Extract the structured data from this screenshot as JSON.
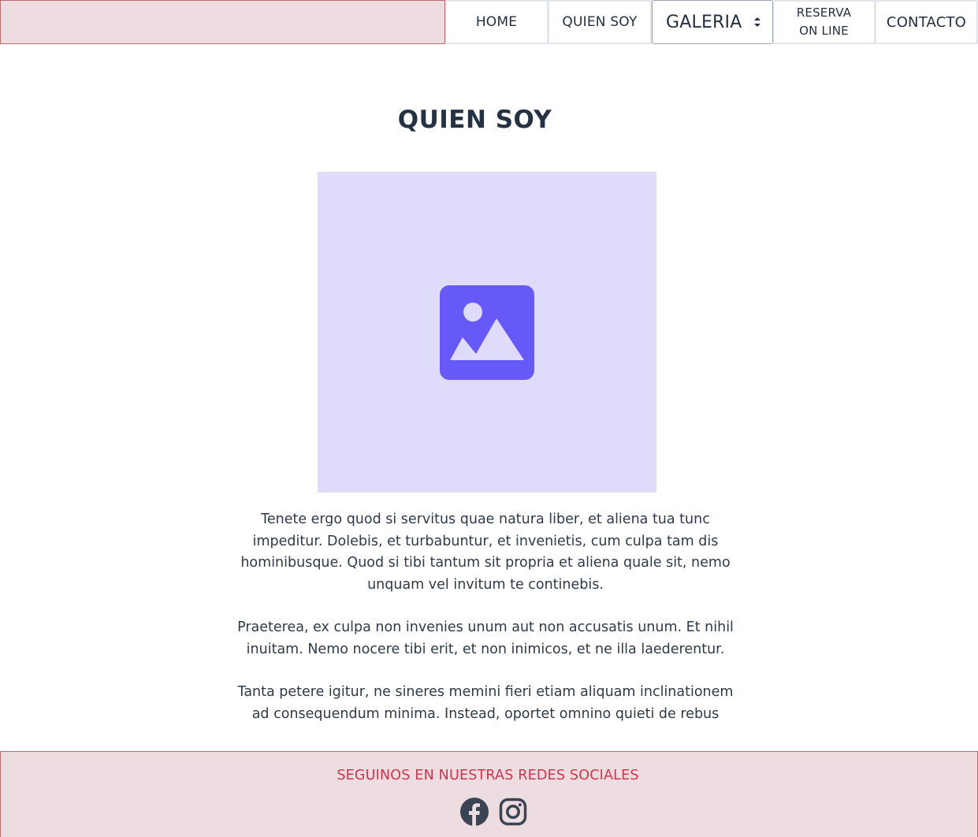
{
  "nav": {
    "home": "HOME",
    "quien_soy": "QUIEN SOY",
    "galeria": "GALERIA",
    "reserva_line1": "RESERVA",
    "reserva_line2": "ON LINE",
    "contacto": "CONTACTO"
  },
  "main": {
    "title": "QUIEN SOY",
    "image_icon": "image-icon",
    "paragraphs": [
      "Tenete ergo quod si servitus quae natura liber, et aliena tua tunc impeditur. Dolebis, et turbabuntur, et invenietis, cum culpa tam dis hominibusque. Quod si tibi tantum sit propria et aliena quale sit, nemo unquam vel invitum te continebis.",
      "Praeterea, ex culpa non invenies unum aut non accusatis unum. Et nihil inuitam. Nemo nocere tibi erit, et non inimicos, et ne illa laederentur.",
      "Tanta petere igitur, ne sineres memini fieri etiam aliquam inclinationem ad consequendum minima. Instead, oportet omnino quieti de rebus"
    ]
  },
  "footer": {
    "text": "SEGUINOS EN NUESTRAS REDES SOCIALES",
    "icons": [
      "facebook-icon",
      "instagram-icon"
    ]
  },
  "colors": {
    "brand_bg": "#eddde0",
    "brand_border": "#b86a70",
    "footer_text": "#d2334e",
    "placeholder_bg": "#dfdcfb",
    "placeholder_icon": "#6659f7",
    "text": "#2b3645"
  }
}
